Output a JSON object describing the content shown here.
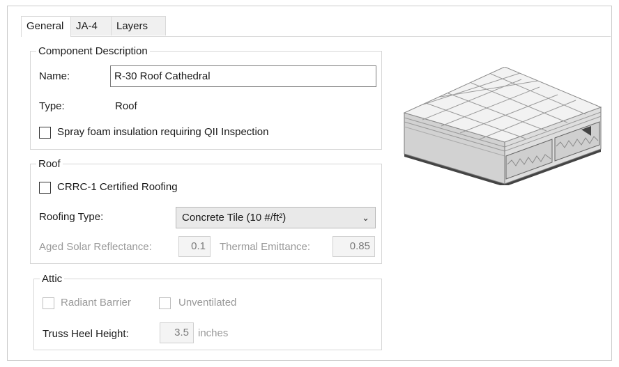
{
  "tabs": [
    {
      "label": "General",
      "active": true
    },
    {
      "label": "JA-4",
      "active": false
    },
    {
      "label": "Layers",
      "active": false
    }
  ],
  "component_description": {
    "legend": "Component Description",
    "name_label": "Name:",
    "name_value": "R-30 Roof Cathedral",
    "type_label": "Type:",
    "type_value": "Roof",
    "spray_foam_label": "Spray foam insulation requiring QII Inspection",
    "spray_foam_checked": false
  },
  "roof": {
    "legend": "Roof",
    "crrc_label": "CRRC-1 Certified Roofing",
    "crrc_checked": false,
    "roofing_type_label": "Roofing Type:",
    "roofing_type_value": "Concrete Tile (10 #/ft²)",
    "aged_solar_label": "Aged Solar Reflectance:",
    "aged_solar_value": "0.1",
    "thermal_emittance_label": "Thermal Emittance:",
    "thermal_emittance_value": "0.85"
  },
  "attic": {
    "legend": "Attic",
    "radiant_barrier_label": "Radiant Barrier",
    "unventilated_label": "Unventilated",
    "truss_heel_label": "Truss Heel Height:",
    "truss_heel_value": "3.5",
    "truss_heel_unit": "inches"
  },
  "preview": {
    "icon": "roof-cathedral-illustration"
  },
  "colors": {
    "border": "#d6d6d6",
    "disabled_text": "#9a9a9a",
    "field_bg": "#f4f4f4"
  }
}
